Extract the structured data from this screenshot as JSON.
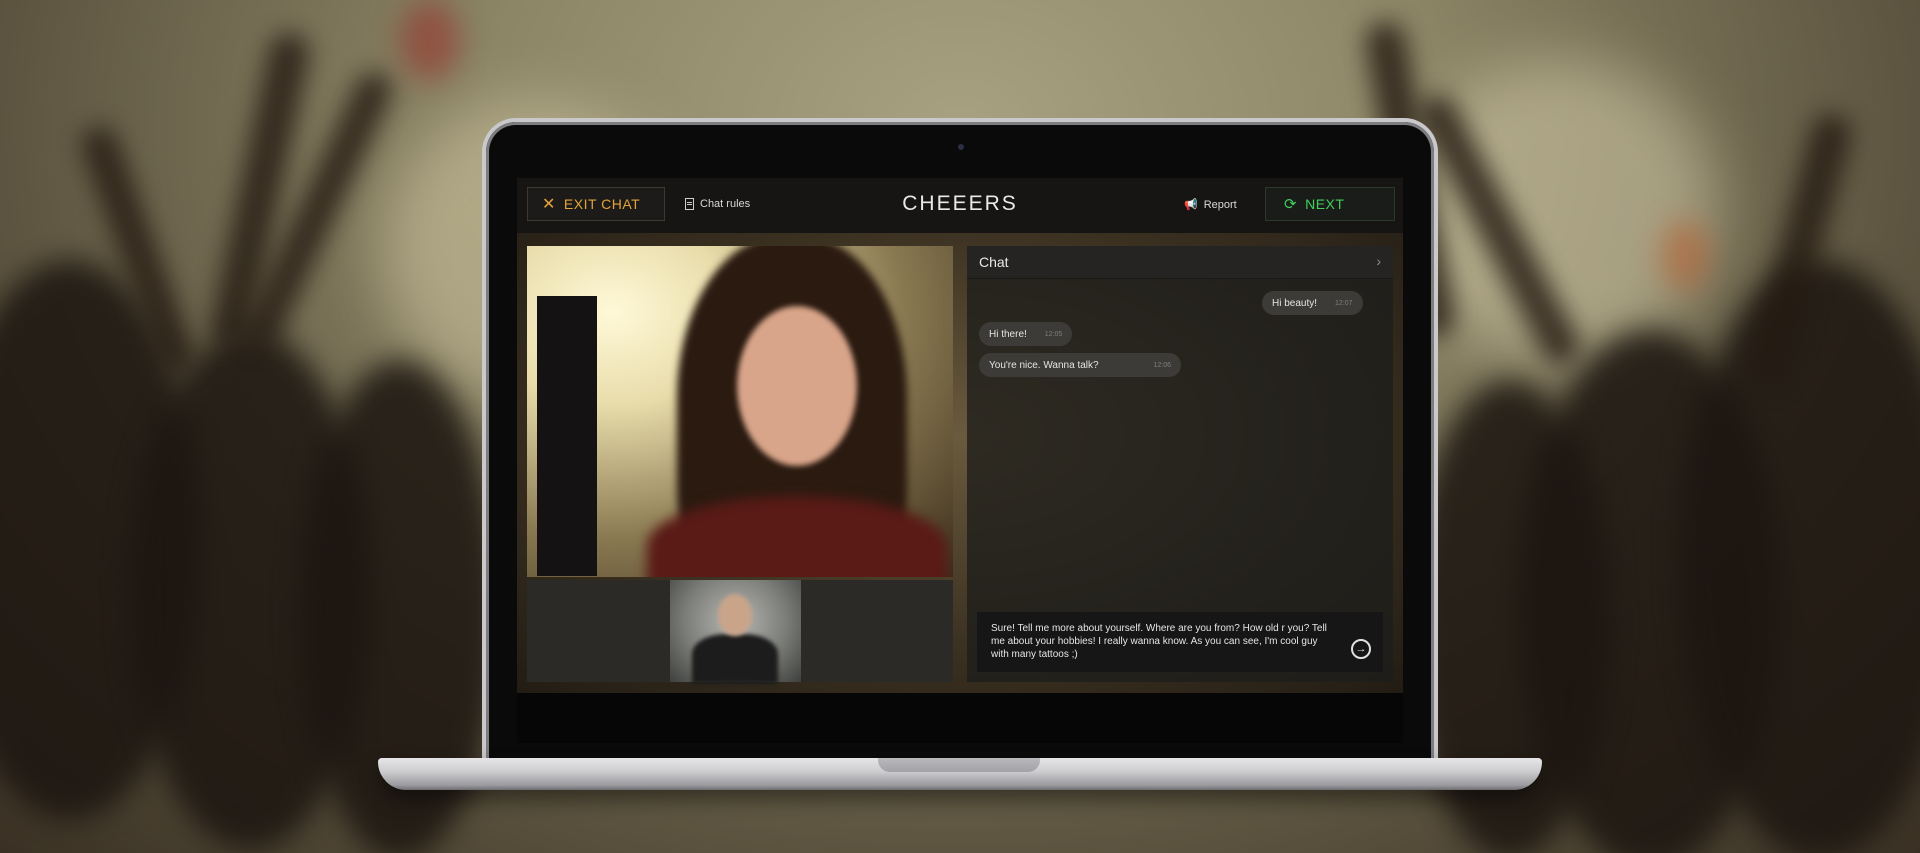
{
  "app": {
    "logo": "CHEEERS",
    "exit_label": "EXIT CHAT",
    "rules_label": "Chat rules",
    "report_label": "Report",
    "next_label": "NEXT"
  },
  "chat": {
    "title": "Chat",
    "messages": [
      {
        "text": "Hi beauty!",
        "time": "12:07",
        "side": "right"
      },
      {
        "text": "Hi there!",
        "time": "12:05",
        "side": "left"
      },
      {
        "text": "You're nice. Wanna talk?",
        "time": "12:06",
        "side": "left"
      }
    ],
    "input_text": "Sure! Tell me more about yourself. Where are you from? How old r you? Tell me about your hobbies! I really wanna know. As you can see, I'm cool guy with many tattoos ;)"
  },
  "colors": {
    "exit_accent": "#e2a43a",
    "next_accent": "#3fcf5b"
  }
}
